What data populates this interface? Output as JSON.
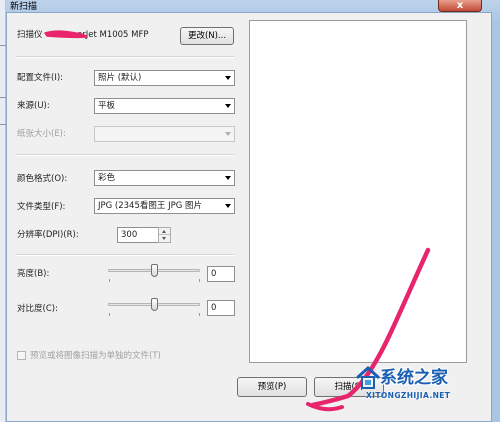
{
  "window": {
    "title": "新扫描",
    "close_glyph": "x"
  },
  "scanner": {
    "label_prefix": "扫描仪",
    "label_suffix": "erJet M1005 MFP",
    "change_button": "更改(N)..."
  },
  "form": {
    "profile": {
      "label": "配置文件(I):",
      "value": "照片 (默认)"
    },
    "source": {
      "label": "来源(U):",
      "value": "平板"
    },
    "paper_size": {
      "label": "纸张大小(E):",
      "value": ""
    },
    "color_format": {
      "label": "颜色格式(O):",
      "value": "彩色"
    },
    "file_type": {
      "label": "文件类型(F):",
      "value": "JPG (2345看图王 JPG 图片"
    },
    "resolution": {
      "label": "分辨率(DPI)(R):",
      "value": "300"
    },
    "brightness": {
      "label": "亮度(B):",
      "value": "0",
      "level": 0.5
    },
    "contrast": {
      "label": "对比度(C):",
      "value": "0",
      "level": 0.5
    },
    "separate_files": {
      "label": "预览或将图像扫描为单独的文件(T)",
      "checked": false
    }
  },
  "buttons": {
    "preview": "预览(P)",
    "scan": "扫描(S)"
  },
  "watermark": {
    "title": "系统之家",
    "url": "XITONGZHIJIA.NET"
  },
  "colors": {
    "scribble": "#e8256c",
    "watermark_blue": "#1a5fb4"
  }
}
